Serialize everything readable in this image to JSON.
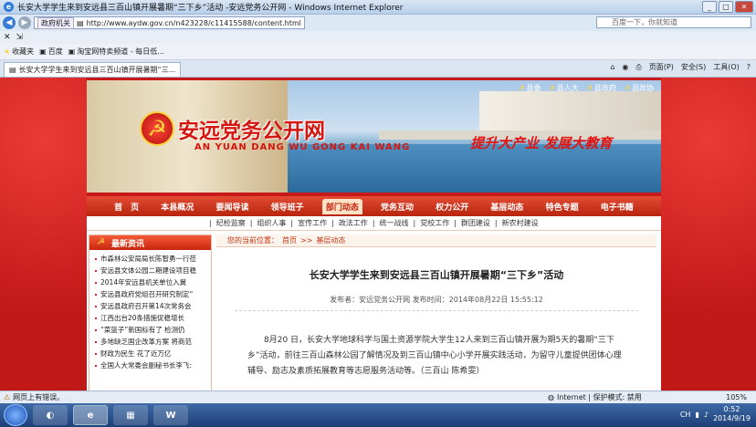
{
  "window": {
    "title": "长安大学学生来到安远县三百山镇开展暑期“三下乡”活动 -安远党务公开网 - Windows Internet Explorer"
  },
  "nav": {
    "tag": "政府机关",
    "url": "http://www.aydw.gov.cn/n423228/c11415588/content.html",
    "search_placeholder": "百度一下，你就知道"
  },
  "favbar": {
    "label": "收藏夹",
    "items": [
      "百度",
      "淘宝网特卖频道 - 每日低..."
    ]
  },
  "tab": {
    "label": "长安大学学生来到安远县三百山镇开展暑期“三..."
  },
  "cmdbar": {
    "page": "页面(P)",
    "safety": "安全(S)",
    "tools": "工具(O)"
  },
  "site": {
    "toplinks": [
      "县委",
      "县人大",
      "县政府",
      "县政协"
    ],
    "name": "安远党务公开网",
    "pinyin": "AN YUAN DANG WU GONG KAI WANG",
    "slogan": "提升大产业 发展大教育",
    "mainnav": [
      "首　页",
      "本县概况",
      "要闻导读",
      "领导班子",
      "部门动态",
      "党务互动",
      "权力公开",
      "基层动态",
      "特色专题",
      "电子书籍"
    ],
    "mainnav_active": "部门动态",
    "subnav": [
      "纪检监察",
      "组织人事",
      "宣传工作",
      "政法工作",
      "统一战线",
      "党校工作",
      "群团建设",
      "新农村建设"
    ]
  },
  "sidebar": {
    "title": "最新资讯",
    "items": [
      "市森林公安局局长陈智勇一行莅",
      "安远县文体公园二期建设项目稳",
      "2014年安远县机关单位入冀",
      "安远县政府党组召开研究制定“",
      "安远县政府召开第14次常务会",
      "江西出台20条措施促稳增长",
      "“菜篮子”新国标有了 检测仍",
      "多地缺乏国企改革方案 将商范",
      "财政为民生 花了近万亿",
      "全国人大常委会副秘书长李飞:"
    ]
  },
  "article": {
    "crumb_label": "您的当前位置：",
    "crumb_home": "首页",
    "crumb_sep": ">>",
    "crumb_section": "基层动态",
    "title": "长安大学学生来到安远县三百山镇开展暑期“三下乡”活动",
    "meta": "发布者：安远党务公开网  发布时间：2014年08月22日  15:55:12",
    "body": "8月20 日，长安大学地球科学与国土资源学院大学生12人来到三百山镇开展为期5天的暑期“三下乡”活动，前往三百山森林公园了解情况及到三百山镇中心小学开展实践活动，为留守儿童提供团体心理辅导、励志及素质拓展教育等志愿服务活动等。（三百山  陈希雯）"
  },
  "status": {
    "text": "网页上有错误。",
    "zone": "Internet | 保护模式: 禁用",
    "zoom": "105%"
  },
  "taskbar": {
    "time": "0:52",
    "date": "2014/9/19",
    "word_label": "W"
  }
}
